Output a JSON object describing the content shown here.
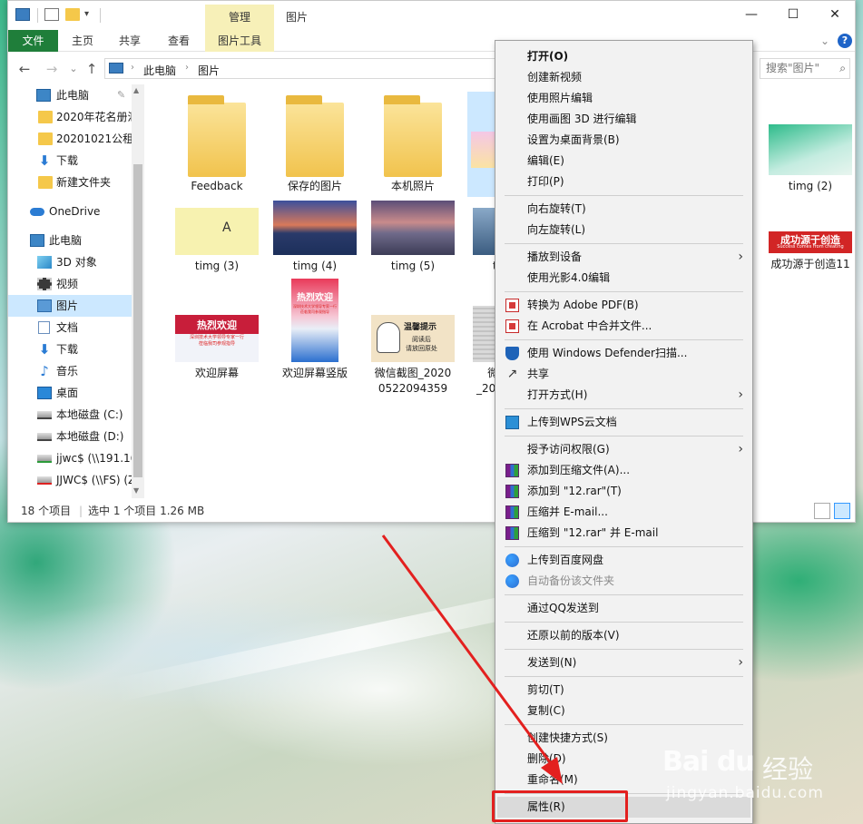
{
  "window": {
    "title": "图片",
    "manage_tab": "管理",
    "min_glyph": "—",
    "max_glyph": "☐",
    "close_glyph": "✕"
  },
  "ribbon": {
    "tabs": [
      "文件",
      "主页",
      "共享",
      "查看",
      "图片工具"
    ],
    "expand_glyph": "⌄",
    "help_glyph": "?"
  },
  "address": {
    "crumbs": [
      "此电脑",
      "图片"
    ],
    "search_placeholder": "搜索\"图片\"",
    "search_glyph": "⌕",
    "back_glyph": "←",
    "forward_glyph": "→",
    "dropdown_glyph": "⌄",
    "up_glyph": "↑"
  },
  "nav": {
    "items": [
      {
        "label": "此电脑",
        "icon": "pc-icon"
      },
      {
        "label": "2020年花名册汇",
        "icon": "folder-icon"
      },
      {
        "label": "20201021公租房",
        "icon": "folder-icon"
      },
      {
        "label": "下载",
        "icon": "download-icon"
      },
      {
        "label": "新建文件夹",
        "icon": "folder-icon"
      },
      {
        "label": "OneDrive",
        "icon": "cloud-icon"
      },
      {
        "label": "此电脑",
        "icon": "pc-icon"
      },
      {
        "label": "3D 对象",
        "icon": "cube-icon"
      },
      {
        "label": "视频",
        "icon": "video-icon"
      },
      {
        "label": "图片",
        "icon": "pictures-icon"
      },
      {
        "label": "文档",
        "icon": "document-icon"
      },
      {
        "label": "下载",
        "icon": "download-icon"
      },
      {
        "label": "音乐",
        "icon": "music-icon"
      },
      {
        "label": "桌面",
        "icon": "desktop-icon"
      },
      {
        "label": "本地磁盘 (C:)",
        "icon": "drive-icon"
      },
      {
        "label": "本地磁盘 (D:)",
        "icon": "drive-icon"
      },
      {
        "label": "jjwc$ (\\\\191.16",
        "icon": "network-drive-icon"
      },
      {
        "label": "JJWC$ (\\\\FS) (Z",
        "icon": "network-drive-error-icon"
      }
    ]
  },
  "files": [
    {
      "label": "Feedback",
      "kind": "folder"
    },
    {
      "label": "保存的图片",
      "kind": "folder"
    },
    {
      "label": "本机照片",
      "kind": "folder"
    },
    {
      "label": "timg (2)",
      "kind": "image"
    },
    {
      "label": "timg (3)",
      "kind": "image"
    },
    {
      "label": "timg (4)",
      "kind": "image"
    },
    {
      "label": "timg (5)",
      "kind": "image"
    },
    {
      "label": "ti",
      "kind": "image"
    },
    {
      "label": "成功源于创造11",
      "kind": "image"
    },
    {
      "label": "欢迎屏幕",
      "kind": "image"
    },
    {
      "label": "欢迎屏幕竖版",
      "kind": "image"
    },
    {
      "label": "微信截图_20200522094359",
      "kind": "image"
    },
    {
      "label": "微\n_2020",
      "kind": "image"
    }
  ],
  "thumb_text": {
    "welcome": "热烈欢迎",
    "welcome_sub": "深圳技术大学领导专家一行\n莅临我司参观指导",
    "wechat_title": "温馨提示",
    "wechat_body": "阅读后\n请放回原处",
    "creation_title": "成功源于创造",
    "creation_sub": "Success comes from creating"
  },
  "status": {
    "count": "18 个项目",
    "selection": "选中 1 个项目  1.26 MB"
  },
  "context_menu": {
    "items": [
      {
        "label": "打开(O)",
        "bold": true
      },
      {
        "label": "创建新视频"
      },
      {
        "label": "使用照片编辑"
      },
      {
        "label": "使用画图 3D 进行编辑"
      },
      {
        "label": "设置为桌面背景(B)"
      },
      {
        "label": "编辑(E)"
      },
      {
        "label": "打印(P)"
      },
      {
        "sep": true
      },
      {
        "label": "向右旋转(T)"
      },
      {
        "label": "向左旋转(L)"
      },
      {
        "sep": true
      },
      {
        "label": "播放到设备",
        "submenu": true
      },
      {
        "label": "使用光影4.0编辑"
      },
      {
        "sep": true
      },
      {
        "label": "转换为 Adobe PDF(B)",
        "icon": "pdf-icon"
      },
      {
        "label": "在 Acrobat 中合并文件...",
        "icon": "pdf-icon"
      },
      {
        "sep": true
      },
      {
        "label": "使用 Windows Defender扫描...",
        "icon": "shield-icon"
      },
      {
        "label": "共享",
        "icon": "share-icon"
      },
      {
        "label": "打开方式(H)",
        "submenu": true
      },
      {
        "sep": true
      },
      {
        "label": "上传到WPS云文档",
        "icon": "wps-icon"
      },
      {
        "sep": true
      },
      {
        "label": "授予访问权限(G)",
        "submenu": true
      },
      {
        "label": "添加到压缩文件(A)...",
        "icon": "rar-icon"
      },
      {
        "label": "添加到 \"12.rar\"(T)",
        "icon": "rar-icon"
      },
      {
        "label": "压缩并 E-mail...",
        "icon": "rar-icon"
      },
      {
        "label": "压缩到 \"12.rar\" 并 E-mail",
        "icon": "rar-icon"
      },
      {
        "sep": true
      },
      {
        "label": "上传到百度网盘",
        "icon": "baidu-icon"
      },
      {
        "label": "自动备份该文件夹",
        "icon": "baidu-icon",
        "disabled": true
      },
      {
        "sep": true
      },
      {
        "label": "通过QQ发送到"
      },
      {
        "sep": true
      },
      {
        "label": "还原以前的版本(V)"
      },
      {
        "sep": true
      },
      {
        "label": "发送到(N)",
        "submenu": true
      },
      {
        "sep": true
      },
      {
        "label": "剪切(T)"
      },
      {
        "label": "复制(C)"
      },
      {
        "sep": true
      },
      {
        "label": "创建快捷方式(S)"
      },
      {
        "label": "删除(D)"
      },
      {
        "label": "重命名(M)"
      },
      {
        "sep": true
      },
      {
        "label": "属性(R)",
        "hover": true
      }
    ]
  },
  "watermark": {
    "logo": "Bai du",
    "cn": "经验",
    "url": "jingyan.baidu.com"
  },
  "colors": {
    "file_tab": "#1f7e3a",
    "tools_tab": "#f7f0b8",
    "selection": "#cce8ff",
    "annotation_red": "#e3201f"
  }
}
